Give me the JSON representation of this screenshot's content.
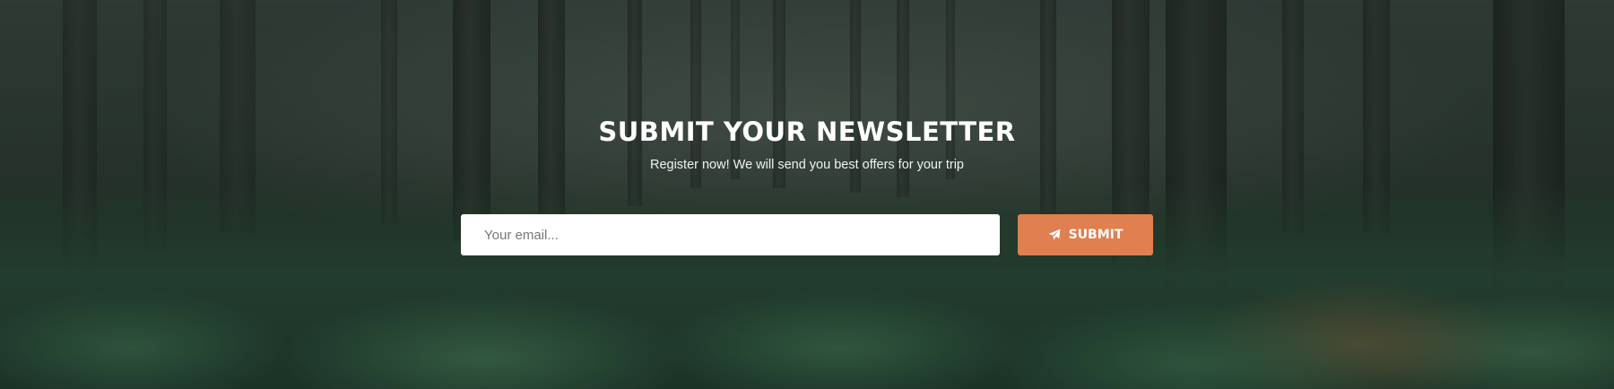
{
  "newsletter": {
    "title": "SUBMIT YOUR NEWSLETTER",
    "subtitle": "Register now! We will send you best offers for your trip",
    "email_placeholder": "Your email...",
    "submit_label": "SUBMIT",
    "submit_icon": "paper-plane-icon"
  },
  "colors": {
    "button": "#e07f50",
    "title_text": "#ffffff",
    "input_background": "#ffffff"
  }
}
